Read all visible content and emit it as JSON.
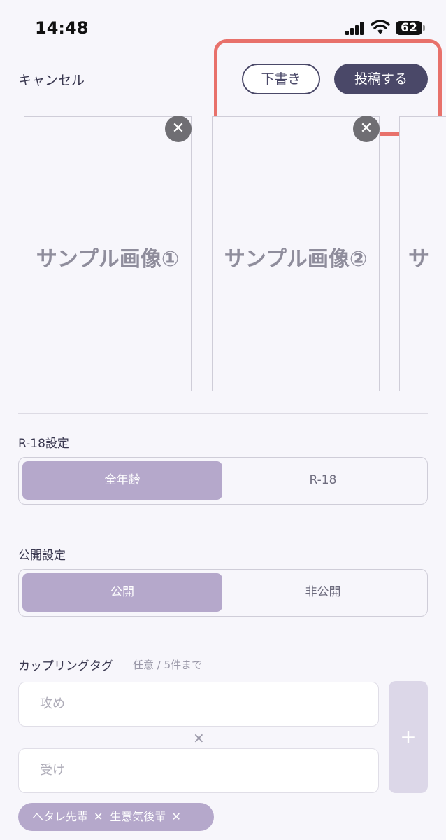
{
  "status_bar": {
    "time": "14:48",
    "battery": "62"
  },
  "header": {
    "cancel_label": "キャンセル",
    "draft_label": "下書き",
    "post_label": "投稿する"
  },
  "images": [
    {
      "label": "サンプル画像①",
      "remove": "✕"
    },
    {
      "label": "サンプル画像②",
      "remove": "✕"
    },
    {
      "label": "サ"
    }
  ],
  "rating": {
    "label": "R-18設定",
    "options": [
      "全年齢",
      "R-18"
    ],
    "selected": "全年齢"
  },
  "visibility": {
    "label": "公開設定",
    "options": [
      "公開",
      "非公開"
    ],
    "selected": "公開"
  },
  "coupling_tag": {
    "label": "カップリングタグ",
    "hint": "任意 / 5件まで",
    "attacker_placeholder": "攻め",
    "receiver_placeholder": "受け",
    "separator": "×",
    "add_label": "+",
    "tags": [
      {
        "name": "ヘタレ先輩",
        "remove": "✕"
      },
      {
        "name": "生意気後輩",
        "remove": "✕"
      }
    ]
  },
  "colors": {
    "accent": "#4a4868",
    "selected_segment": "#b5a8cb",
    "highlight": "#e8716b"
  }
}
